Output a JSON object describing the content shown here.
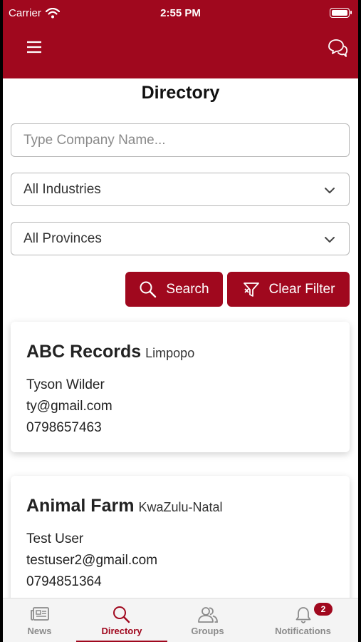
{
  "status": {
    "carrier": "Carrier",
    "time": "2:55 PM",
    "battery_level": 1.0
  },
  "header": {
    "title": "Directory"
  },
  "search": {
    "placeholder": "Type Company Name...",
    "value": ""
  },
  "filters": {
    "industry": "All Industries",
    "province": "All Provinces"
  },
  "actions": {
    "search_label": "Search",
    "clear_label": "Clear Filter"
  },
  "results": [
    {
      "name": "ABC Records",
      "province": "Limpopo",
      "contact": "Tyson Wilder",
      "email": "ty@gmail.com",
      "phone": "0798657463"
    },
    {
      "name": "Animal Farm",
      "province": "KwaZulu-Natal",
      "contact": "Test User",
      "email": "testuser2@gmail.com",
      "phone": "0794851364"
    }
  ],
  "tabs": [
    {
      "label": "News",
      "icon": "newspaper-icon"
    },
    {
      "label": "Directory",
      "icon": "search-icon",
      "active": true
    },
    {
      "label": "Groups",
      "icon": "users-icon"
    },
    {
      "label": "Notifications",
      "icon": "bell-icon",
      "badge": "2"
    }
  ],
  "colors": {
    "brand": "#a0081e",
    "inactive_tab": "#8b8b8b"
  }
}
